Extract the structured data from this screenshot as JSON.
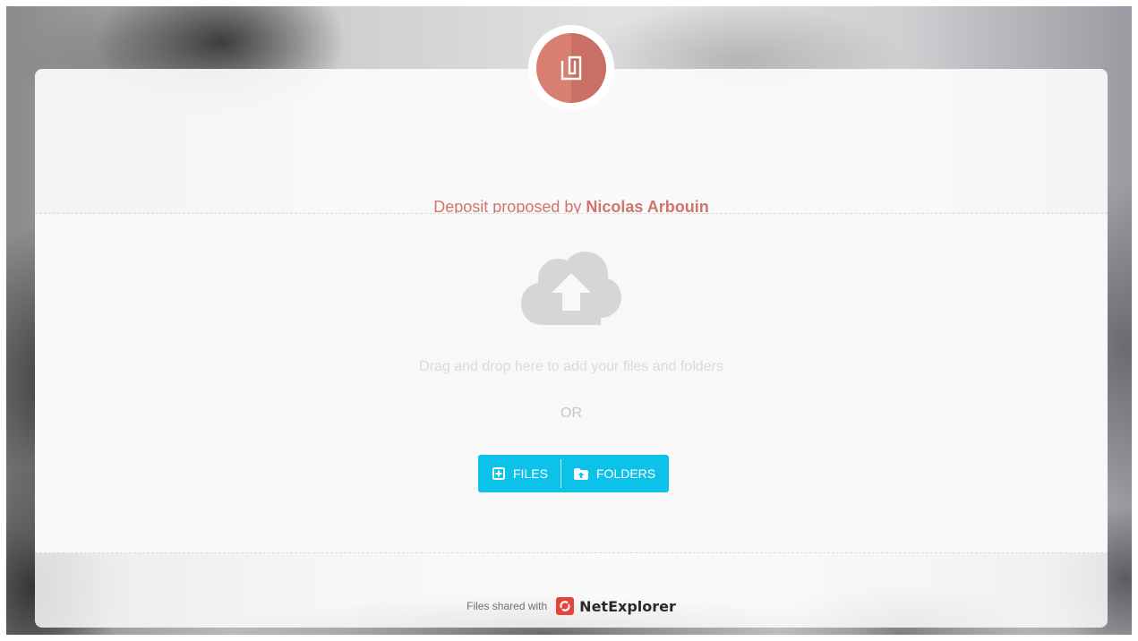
{
  "header": {
    "prefix": "Deposit proposed by ",
    "owner": "Nicolas Arbouin",
    "logo_icon": "paperclip-icon",
    "logo_color": "#d97f72"
  },
  "dropzone": {
    "icon": "cloud-upload-icon",
    "instruction": "Drag and drop here to add your files and folders",
    "separator": "OR"
  },
  "buttons": {
    "files": {
      "label": "FILES",
      "icon": "file-add-icon"
    },
    "folders": {
      "label": "FOLDERS",
      "icon": "folder-upload-icon"
    },
    "color": "#0dc2e9"
  },
  "footer": {
    "label": "Files shared with",
    "brand": "NetExplorer",
    "brand_color": "#e8423d"
  }
}
